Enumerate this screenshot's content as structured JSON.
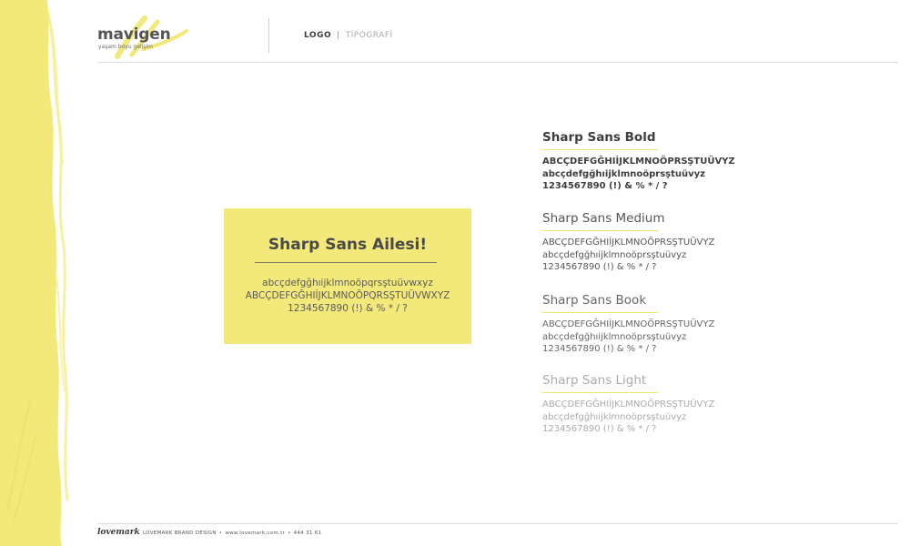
{
  "brand": {
    "name": "mavigen",
    "tagline": "yaşam boyu gelişim",
    "accent_color": "#f3e97b",
    "text_color": "#4a4a4a"
  },
  "nav": {
    "logo": "LOGO",
    "separator": "|",
    "typography": "TİPOGRAFİ"
  },
  "card": {
    "title": "Sharp Sans Ailesi!",
    "lowercase": "abcçdefgğhıijklmnoöpqrsştuüvwxyz",
    "uppercase": "ABCÇDEFGĞHIİJKLMNOÖPQRSŞTUÜVWXYZ",
    "numbers": "1234567890 (!) & % * / ?"
  },
  "specimens": [
    {
      "name": "Sharp Sans Bold",
      "upper": "ABCÇDEFGĞHIİJKLMNOÖPRSŞTUÜVYZ",
      "lower": "abcçdefgğhıijklmnoöprsştuüvyz",
      "numbers": "1234567890 (!) & % * / ?"
    },
    {
      "name": "Sharp Sans Medium",
      "upper": "ABCÇDEFGĞHIİJKLMNOÖPRSŞTUÜVYZ",
      "lower": "abcçdefgğhıijklmnoöprsştuüvyz",
      "numbers": "1234567890 (!) & % * / ?"
    },
    {
      "name": "Sharp Sans Book",
      "upper": "ABCÇDEFGĞHIİJKLMNOÖPRSŞTUÜVYZ",
      "lower": "abcçdefgğhıijklmnoöprsştuüvyz",
      "numbers": "1234567890 (!) & % * / ?"
    },
    {
      "name": "Sharp Sans Light",
      "upper": "ABCÇDEFGĞHIİJKLMNOÖPRSŞTUÜVYZ",
      "lower": "abcçdefgğhıijklmnoöprsştuüvyz",
      "numbers": "1234567890 (!) & % * / ?"
    }
  ],
  "footer": {
    "logo": "lovemark",
    "company": "LOVEMARK BRAND DESIGN",
    "website": "www.lovemark.com.tr",
    "phone": "444 31 61",
    "separator": "•"
  }
}
